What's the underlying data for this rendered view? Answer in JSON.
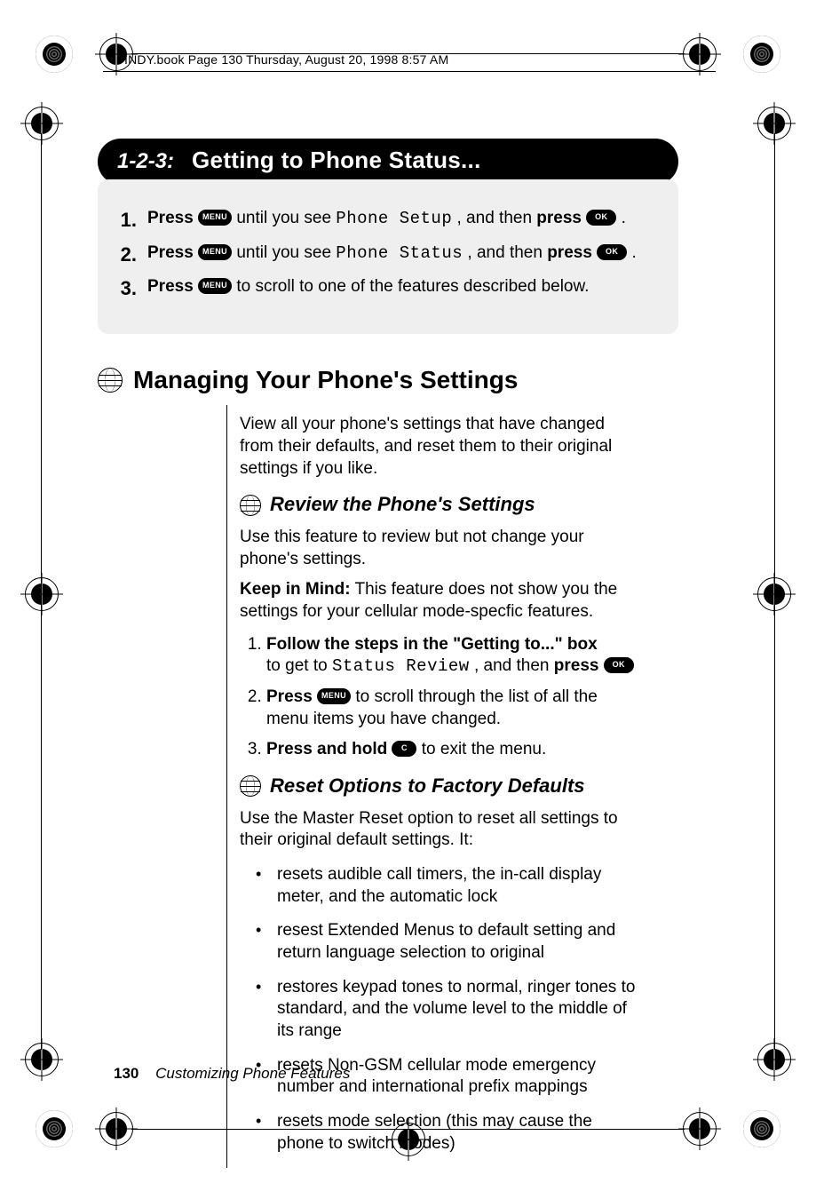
{
  "runhead": "INDY.book  Page 130  Thursday, August 20, 1998  8:57 AM",
  "banner": {
    "tag": "1-2-3:",
    "title": "Getting to Phone Status..."
  },
  "keys": {
    "menu": "MENU",
    "ok": "OK",
    "c": "C"
  },
  "lcd": {
    "phone_setup": "Phone Setup",
    "phone_status": "Phone Status",
    "status_review": "Status Review"
  },
  "steps": {
    "s1": {
      "num": "1.",
      "pre": "Press ",
      "mid": " until you see ",
      "post": ", and then ",
      "press": "press ",
      "end": "."
    },
    "s2": {
      "num": "2.",
      "pre": "Press ",
      "mid": " until you see ",
      "post": ", and then ",
      "press": "press ",
      "end": "."
    },
    "s3": {
      "num": "3.",
      "pre": "Press ",
      "rest": " to scroll to one of the features described below."
    }
  },
  "section_title": "Managing Your Phone's Settings",
  "intro": "View all your phone's settings that have changed from their defaults, and reset them to their original settings if you like.",
  "sub1": "Review the Phone's Settings",
  "sub1_p1": "Use this feature to review but not change your phone's settings.",
  "keep_label": "Keep in Mind:",
  "keep_text": " This feature does not show you the settings for your cellular mode-specfic features.",
  "inner_steps": {
    "i1": {
      "num": "1.",
      "lab": "Follow the steps in the \"Getting to...\" box",
      "rest_a": "to get to ",
      "rest_b": ", and then ",
      "press": "press "
    },
    "i2": {
      "num": "2.",
      "lab": "Press ",
      "rest": "  to scroll through the list of all the menu items you have changed."
    },
    "i3": {
      "num": "3.",
      "lab": "Press and hold ",
      "rest": " to exit the menu."
    }
  },
  "sub2": "Reset Options to Factory Defaults",
  "sub2_p1": "Use the Master Reset option to reset all settings to their original default settings. It:",
  "bullets": [
    "resets audible call timers, the in-call display meter, and the automatic lock",
    "resest Extended Menus to default setting and return language selection to original",
    "restores keypad tones to normal, ringer tones to standard, and the volume level to the middle of its range",
    "resets Non-GSM cellular mode emergency number and international prefix mappings",
    "resets mode selection (this may cause the phone to switch modes)"
  ],
  "footer": {
    "page": "130",
    "chapter": "Customizing Phone Features"
  }
}
